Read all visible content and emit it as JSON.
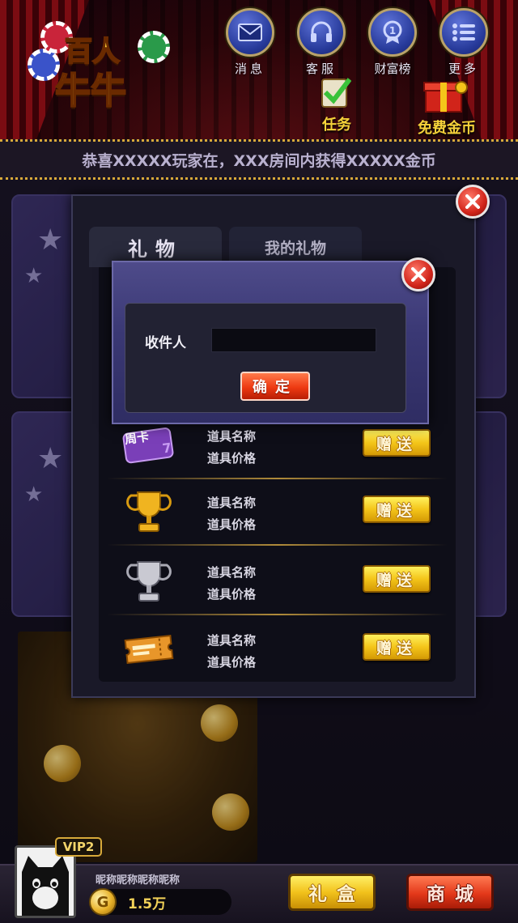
{
  "header": {
    "logo_line1": "百人",
    "logo_line2": "牛牛",
    "buttons": [
      {
        "label": "消息",
        "icon": "envelope-icon"
      },
      {
        "label": "客服",
        "icon": "headset-icon"
      },
      {
        "label": "财富榜",
        "icon": "medal-icon"
      },
      {
        "label": "更多",
        "icon": "menu-list-icon"
      }
    ],
    "task_label": "任务",
    "free_gold_label": "免费金币"
  },
  "marquee": {
    "text": "恭喜XXXXX玩家在，XXX房间内获得XXXXX金币"
  },
  "gift_panel": {
    "tabs": [
      {
        "label": "礼物",
        "active": true
      },
      {
        "label": "我的礼物",
        "active": false
      }
    ],
    "items": [
      {
        "name": "道具名称",
        "price": "道具价格",
        "button": "赠送",
        "icon": "week-card-icon",
        "icon_text": "周卡"
      },
      {
        "name": "道具名称",
        "price": "道具价格",
        "button": "赠送",
        "icon": "gold-trophy-icon"
      },
      {
        "name": "道具名称",
        "price": "道具价格",
        "button": "赠送",
        "icon": "silver-trophy-icon"
      },
      {
        "name": "道具名称",
        "price": "道具价格",
        "button": "赠送",
        "icon": "ticket-icon"
      }
    ]
  },
  "recipient_dialog": {
    "label": "收件人",
    "input_value": "",
    "input_placeholder": "",
    "confirm_label": "确定"
  },
  "player": {
    "vip": "VIP2",
    "nickname": "昵称昵称昵称昵称",
    "gold": "1.5万",
    "coin_symbol": "G"
  },
  "bottom": {
    "gift_box_label": "礼盒",
    "shop_label": "商城"
  },
  "colors": {
    "accent_gold": "#f4c51a",
    "close_red": "#d1241a",
    "dialog_purple": "#3a3874",
    "shop_red": "#e3381a"
  }
}
